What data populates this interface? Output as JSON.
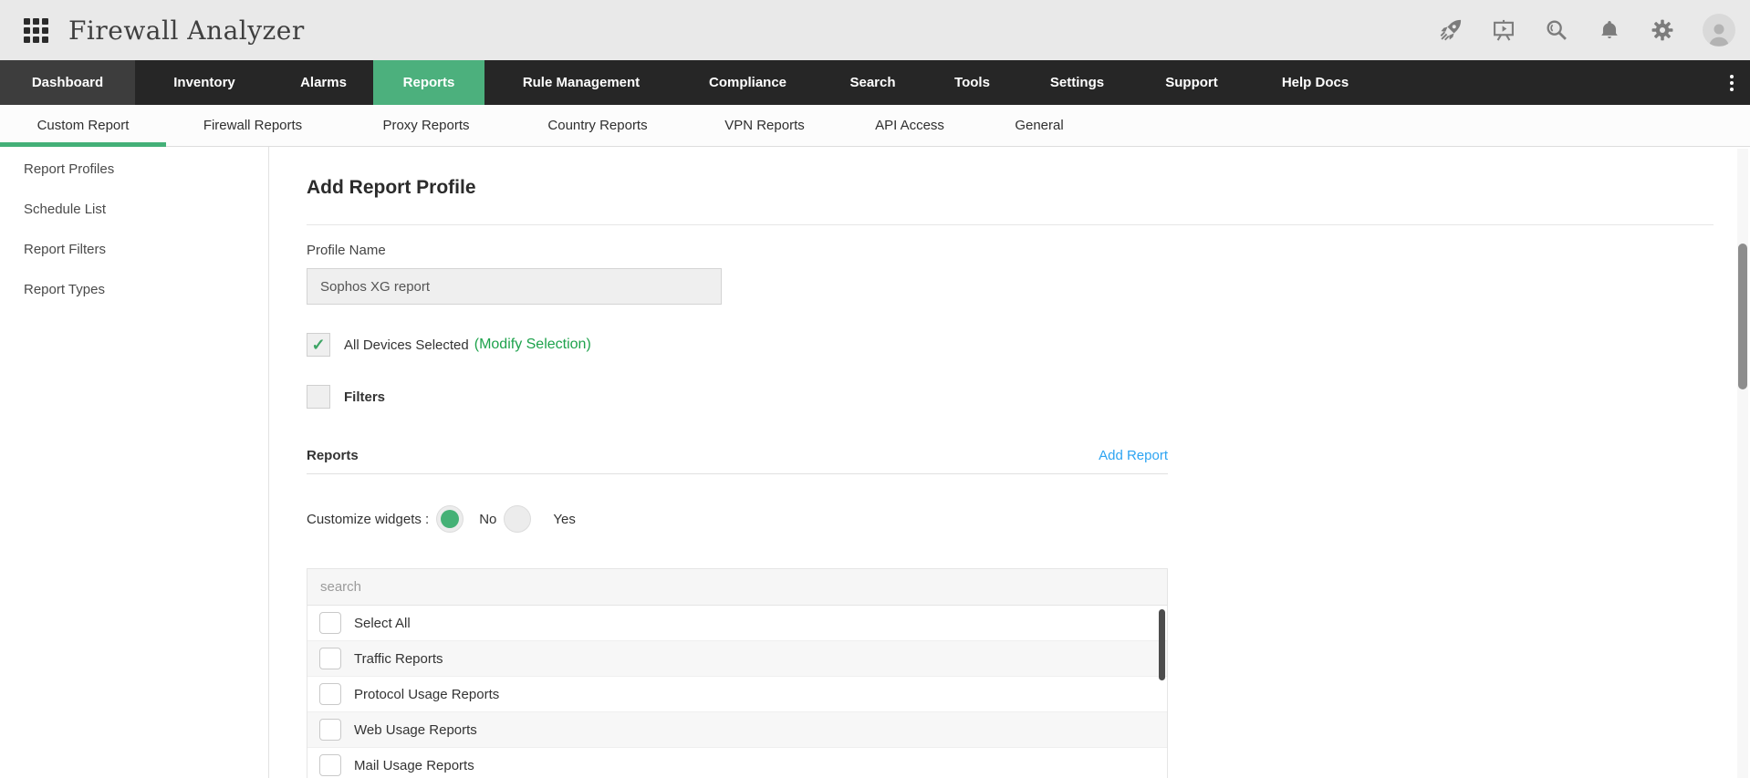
{
  "app": {
    "title": "Firewall Analyzer"
  },
  "nav": {
    "items": [
      {
        "label": "Dashboard"
      },
      {
        "label": "Inventory"
      },
      {
        "label": "Alarms"
      },
      {
        "label": "Reports",
        "active": true
      },
      {
        "label": "Rule Management"
      },
      {
        "label": "Compliance"
      },
      {
        "label": "Search"
      },
      {
        "label": "Tools"
      },
      {
        "label": "Settings"
      },
      {
        "label": "Support"
      },
      {
        "label": "Help Docs"
      }
    ]
  },
  "subnav": {
    "tabs": [
      {
        "label": "Custom Report",
        "active": true
      },
      {
        "label": "Firewall Reports"
      },
      {
        "label": "Proxy Reports"
      },
      {
        "label": "Country Reports"
      },
      {
        "label": "VPN Reports"
      },
      {
        "label": "API Access"
      },
      {
        "label": "General"
      }
    ]
  },
  "sidebar": {
    "items": [
      {
        "label": "Report Profiles"
      },
      {
        "label": "Schedule List"
      },
      {
        "label": "Report Filters"
      },
      {
        "label": "Report Types"
      }
    ]
  },
  "main": {
    "title": "Add Report Profile",
    "profile_name": {
      "label": "Profile Name",
      "value": "Sophos XG report"
    },
    "devices": {
      "label": "All Devices Selected",
      "action": "(Modify Selection)",
      "checked": true
    },
    "filters": {
      "label": "Filters",
      "checked": false
    },
    "reports_section": {
      "heading": "Reports",
      "add_link": "Add Report"
    },
    "customize": {
      "label": "Customize widgets :",
      "options": [
        {
          "label": "No",
          "selected": true
        },
        {
          "label": "Yes",
          "selected": false
        }
      ]
    },
    "report_list": {
      "search_placeholder": "search",
      "items": [
        {
          "label": "Select All",
          "checked": false
        },
        {
          "label": "Traffic Reports",
          "checked": false
        },
        {
          "label": "Protocol Usage Reports",
          "checked": false
        },
        {
          "label": "Web Usage Reports",
          "checked": false
        },
        {
          "label": "Mail Usage Reports",
          "checked": false
        }
      ]
    }
  },
  "colors": {
    "nav_active_green": "#4cb07d",
    "tab_underline_green": "#44b078",
    "action_green": "#1ea24c",
    "link_blue": "#2da4f2"
  }
}
